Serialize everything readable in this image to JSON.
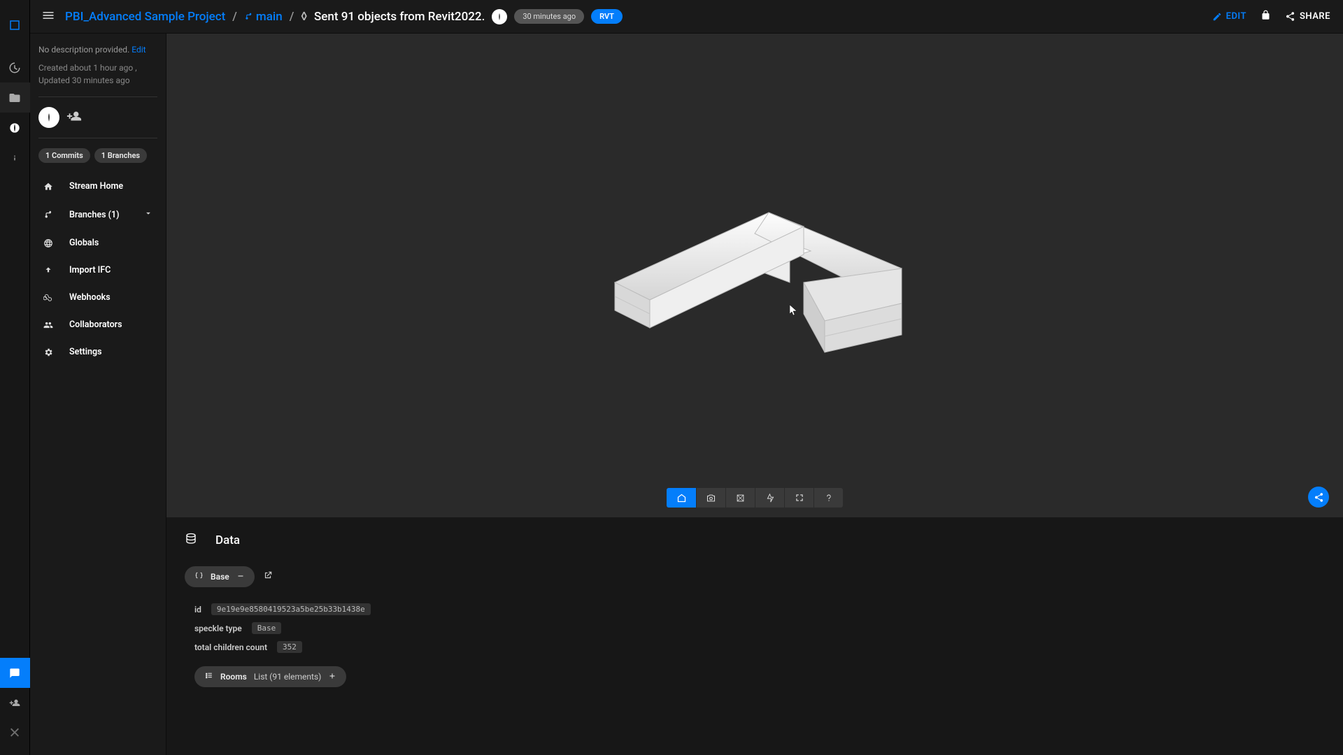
{
  "breadcrumb": {
    "project": "PBI_Advanced Sample Project",
    "branch": "main",
    "commit_title": "Sent 91 objects from Revit2022.",
    "time_chip": "30 minutes ago",
    "app_chip": "RVT"
  },
  "topbar": {
    "edit": "EDIT",
    "share": "SHARE"
  },
  "sidebar": {
    "desc_none": "No description provided.",
    "desc_edit": "Edit",
    "meta": "Created about 1 hour ago , Updated 30 minutes ago",
    "commits_chip": "1 Commits",
    "branches_chip": "1 Branches",
    "nav": {
      "home": "Stream Home",
      "branches": "Branches (1)",
      "globals": "Globals",
      "import_ifc": "Import IFC",
      "webhooks": "Webhooks",
      "collab": "Collaborators",
      "settings": "Settings"
    }
  },
  "data": {
    "header": "Data",
    "base_pill": "Base",
    "rows": {
      "id_k": "id",
      "id_v": "9e19e9e8580419523a5be25b33b1438e",
      "type_k": "speckle type",
      "type_v": "Base",
      "count_k": "total children count",
      "count_v": "352"
    },
    "rooms_label": "Rooms",
    "rooms_sub": "List (91 elements)"
  }
}
